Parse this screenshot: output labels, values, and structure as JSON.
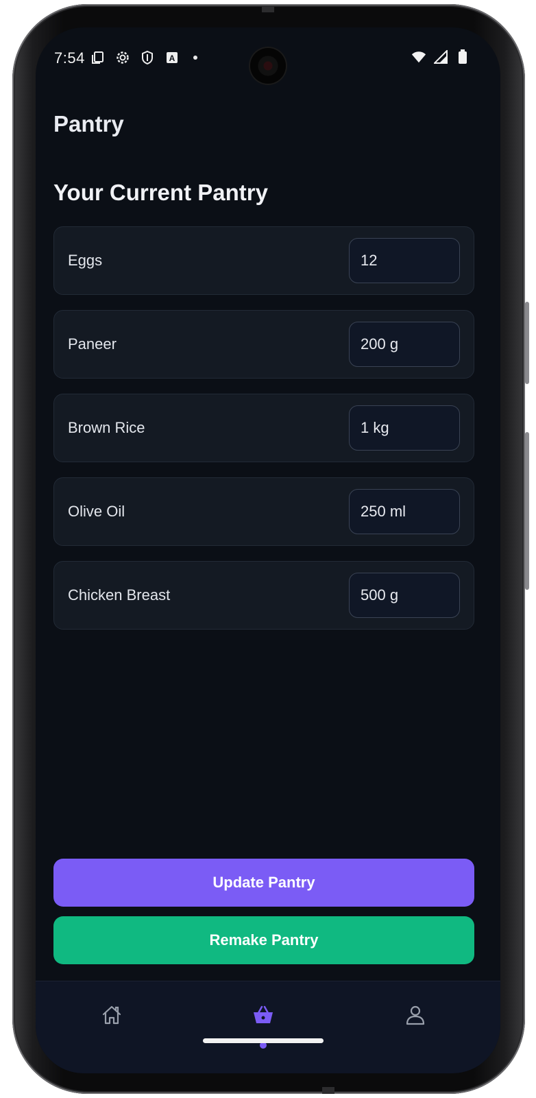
{
  "status_bar": {
    "time": "7:54",
    "left_icons": [
      "screenshot-icon",
      "settings-gear-icon",
      "shield-icon",
      "keyboard-a-icon",
      "dot-icon"
    ],
    "right_icons": [
      "wifi-icon",
      "signal-icon",
      "battery-icon"
    ]
  },
  "app_bar": {
    "title": "Pantry"
  },
  "pantry": {
    "heading": "Your Current Pantry",
    "items": [
      {
        "name": "Eggs",
        "quantity": "12"
      },
      {
        "name": "Paneer",
        "quantity": "200 g"
      },
      {
        "name": "Brown Rice",
        "quantity": "1 kg"
      },
      {
        "name": "Olive Oil",
        "quantity": "250 ml"
      },
      {
        "name": "Chicken Breast",
        "quantity": "500 g"
      }
    ]
  },
  "actions": {
    "update_label": "Update Pantry",
    "remake_label": "Remake Pantry"
  },
  "bottom_nav": {
    "items": [
      "home-icon",
      "basket-icon",
      "profile-icon"
    ],
    "active": "basket-icon"
  },
  "colors": {
    "background": "#0b0f16",
    "card": "#141a23",
    "accent_purple": "#7b5cf5",
    "accent_green": "#10b981"
  }
}
